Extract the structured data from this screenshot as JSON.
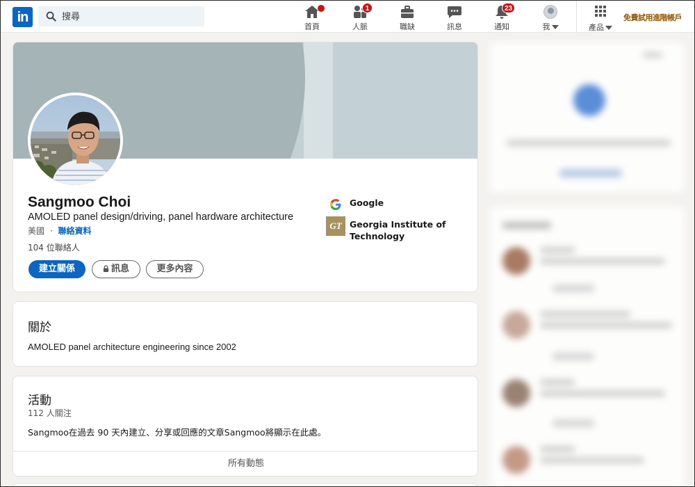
{
  "nav": {
    "search_placeholder": "搜尋",
    "items": [
      {
        "label": "首頁",
        "icon": "home-icon",
        "badge": ""
      },
      {
        "label": "人脈",
        "icon": "people-icon",
        "badge": "1"
      },
      {
        "label": "職缺",
        "icon": "briefcase-icon",
        "badge": ""
      },
      {
        "label": "訊息",
        "icon": "chat-icon",
        "badge": ""
      },
      {
        "label": "通知",
        "icon": "bell-icon",
        "badge": "23"
      },
      {
        "label": "我",
        "icon": "avatar-icon",
        "badge": ""
      },
      {
        "label": "產品",
        "icon": "grid-icon",
        "badge": ""
      }
    ],
    "premium_label": "免費試用進階帳戶"
  },
  "profile": {
    "name": "Sangmoo Choi",
    "headline": "AMOLED panel design/driving, panel hardware architecture",
    "location": "美國",
    "separator": "·",
    "contact_info": "聯絡資料",
    "connections": "104 位聯絡人",
    "connect_button": "建立關係",
    "message_button": "訊息",
    "more_button": "更多內容",
    "experience": [
      {
        "name": "Google",
        "logo": "google-logo"
      },
      {
        "name_line1": "Georgia Institute of",
        "name_line2": "Technology",
        "logo": "georgia-tech-logo",
        "logo_text": "GT"
      }
    ]
  },
  "about": {
    "title": "關於",
    "text": "AMOLED panel architecture engineering since 2002"
  },
  "activity": {
    "title": "活動",
    "followers": "112 人關注",
    "text": "Sangmoo在過去 90 天內建立、分享或回應的文章Sangmoo將顯示在此處。",
    "footer": "所有動態"
  },
  "colors": {
    "brand": "#0a66c2",
    "badge": "#cc1016",
    "premium": "#915907",
    "background": "#f3f2ef"
  }
}
